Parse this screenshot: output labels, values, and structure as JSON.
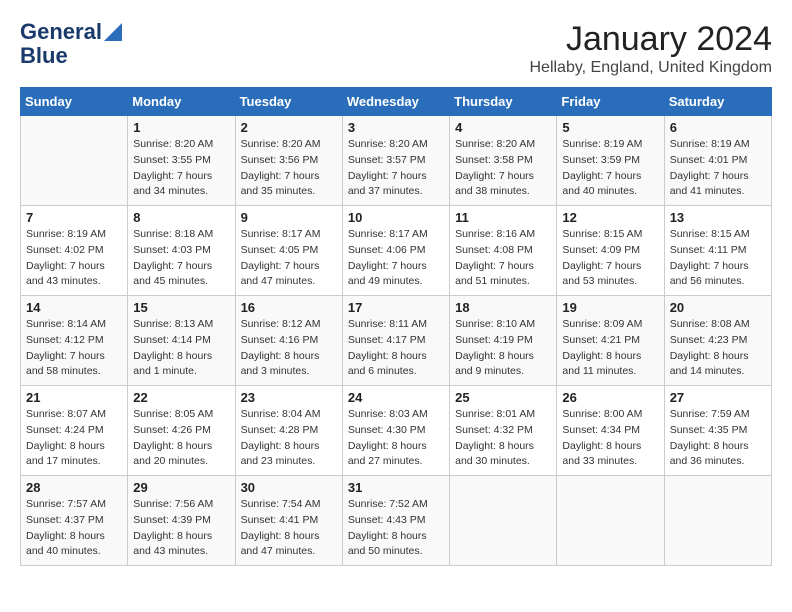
{
  "header": {
    "logo_line1": "General",
    "logo_line2": "Blue",
    "month": "January 2024",
    "location": "Hellaby, England, United Kingdom"
  },
  "weekdays": [
    "Sunday",
    "Monday",
    "Tuesday",
    "Wednesday",
    "Thursday",
    "Friday",
    "Saturday"
  ],
  "weeks": [
    [
      {
        "day": "",
        "info": ""
      },
      {
        "day": "1",
        "info": "Sunrise: 8:20 AM\nSunset: 3:55 PM\nDaylight: 7 hours\nand 34 minutes."
      },
      {
        "day": "2",
        "info": "Sunrise: 8:20 AM\nSunset: 3:56 PM\nDaylight: 7 hours\nand 35 minutes."
      },
      {
        "day": "3",
        "info": "Sunrise: 8:20 AM\nSunset: 3:57 PM\nDaylight: 7 hours\nand 37 minutes."
      },
      {
        "day": "4",
        "info": "Sunrise: 8:20 AM\nSunset: 3:58 PM\nDaylight: 7 hours\nand 38 minutes."
      },
      {
        "day": "5",
        "info": "Sunrise: 8:19 AM\nSunset: 3:59 PM\nDaylight: 7 hours\nand 40 minutes."
      },
      {
        "day": "6",
        "info": "Sunrise: 8:19 AM\nSunset: 4:01 PM\nDaylight: 7 hours\nand 41 minutes."
      }
    ],
    [
      {
        "day": "7",
        "info": "Sunrise: 8:19 AM\nSunset: 4:02 PM\nDaylight: 7 hours\nand 43 minutes."
      },
      {
        "day": "8",
        "info": "Sunrise: 8:18 AM\nSunset: 4:03 PM\nDaylight: 7 hours\nand 45 minutes."
      },
      {
        "day": "9",
        "info": "Sunrise: 8:17 AM\nSunset: 4:05 PM\nDaylight: 7 hours\nand 47 minutes."
      },
      {
        "day": "10",
        "info": "Sunrise: 8:17 AM\nSunset: 4:06 PM\nDaylight: 7 hours\nand 49 minutes."
      },
      {
        "day": "11",
        "info": "Sunrise: 8:16 AM\nSunset: 4:08 PM\nDaylight: 7 hours\nand 51 minutes."
      },
      {
        "day": "12",
        "info": "Sunrise: 8:15 AM\nSunset: 4:09 PM\nDaylight: 7 hours\nand 53 minutes."
      },
      {
        "day": "13",
        "info": "Sunrise: 8:15 AM\nSunset: 4:11 PM\nDaylight: 7 hours\nand 56 minutes."
      }
    ],
    [
      {
        "day": "14",
        "info": "Sunrise: 8:14 AM\nSunset: 4:12 PM\nDaylight: 7 hours\nand 58 minutes."
      },
      {
        "day": "15",
        "info": "Sunrise: 8:13 AM\nSunset: 4:14 PM\nDaylight: 8 hours\nand 1 minute."
      },
      {
        "day": "16",
        "info": "Sunrise: 8:12 AM\nSunset: 4:16 PM\nDaylight: 8 hours\nand 3 minutes."
      },
      {
        "day": "17",
        "info": "Sunrise: 8:11 AM\nSunset: 4:17 PM\nDaylight: 8 hours\nand 6 minutes."
      },
      {
        "day": "18",
        "info": "Sunrise: 8:10 AM\nSunset: 4:19 PM\nDaylight: 8 hours\nand 9 minutes."
      },
      {
        "day": "19",
        "info": "Sunrise: 8:09 AM\nSunset: 4:21 PM\nDaylight: 8 hours\nand 11 minutes."
      },
      {
        "day": "20",
        "info": "Sunrise: 8:08 AM\nSunset: 4:23 PM\nDaylight: 8 hours\nand 14 minutes."
      }
    ],
    [
      {
        "day": "21",
        "info": "Sunrise: 8:07 AM\nSunset: 4:24 PM\nDaylight: 8 hours\nand 17 minutes."
      },
      {
        "day": "22",
        "info": "Sunrise: 8:05 AM\nSunset: 4:26 PM\nDaylight: 8 hours\nand 20 minutes."
      },
      {
        "day": "23",
        "info": "Sunrise: 8:04 AM\nSunset: 4:28 PM\nDaylight: 8 hours\nand 23 minutes."
      },
      {
        "day": "24",
        "info": "Sunrise: 8:03 AM\nSunset: 4:30 PM\nDaylight: 8 hours\nand 27 minutes."
      },
      {
        "day": "25",
        "info": "Sunrise: 8:01 AM\nSunset: 4:32 PM\nDaylight: 8 hours\nand 30 minutes."
      },
      {
        "day": "26",
        "info": "Sunrise: 8:00 AM\nSunset: 4:34 PM\nDaylight: 8 hours\nand 33 minutes."
      },
      {
        "day": "27",
        "info": "Sunrise: 7:59 AM\nSunset: 4:35 PM\nDaylight: 8 hours\nand 36 minutes."
      }
    ],
    [
      {
        "day": "28",
        "info": "Sunrise: 7:57 AM\nSunset: 4:37 PM\nDaylight: 8 hours\nand 40 minutes."
      },
      {
        "day": "29",
        "info": "Sunrise: 7:56 AM\nSunset: 4:39 PM\nDaylight: 8 hours\nand 43 minutes."
      },
      {
        "day": "30",
        "info": "Sunrise: 7:54 AM\nSunset: 4:41 PM\nDaylight: 8 hours\nand 47 minutes."
      },
      {
        "day": "31",
        "info": "Sunrise: 7:52 AM\nSunset: 4:43 PM\nDaylight: 8 hours\nand 50 minutes."
      },
      {
        "day": "",
        "info": ""
      },
      {
        "day": "",
        "info": ""
      },
      {
        "day": "",
        "info": ""
      }
    ]
  ]
}
